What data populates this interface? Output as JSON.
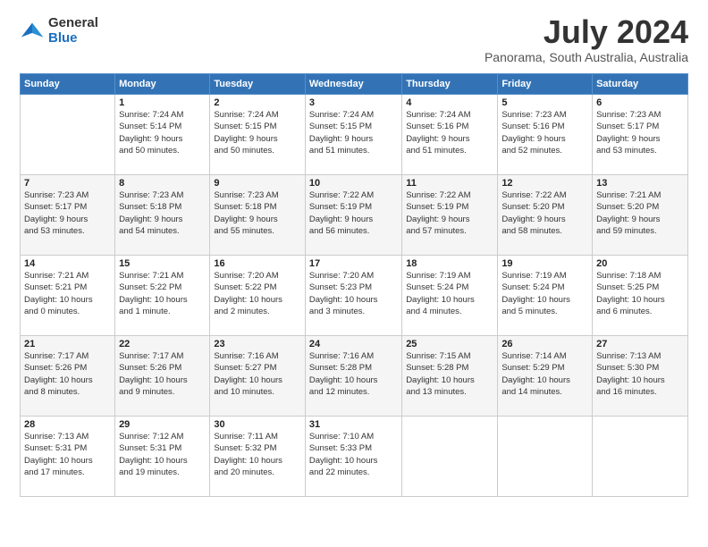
{
  "logo": {
    "line1": "General",
    "line2": "Blue"
  },
  "title": "July 2024",
  "location": "Panorama, South Australia, Australia",
  "header_days": [
    "Sunday",
    "Monday",
    "Tuesday",
    "Wednesday",
    "Thursday",
    "Friday",
    "Saturday"
  ],
  "weeks": [
    [
      {
        "day": "",
        "info": ""
      },
      {
        "day": "1",
        "info": "Sunrise: 7:24 AM\nSunset: 5:14 PM\nDaylight: 9 hours\nand 50 minutes."
      },
      {
        "day": "2",
        "info": "Sunrise: 7:24 AM\nSunset: 5:15 PM\nDaylight: 9 hours\nand 50 minutes."
      },
      {
        "day": "3",
        "info": "Sunrise: 7:24 AM\nSunset: 5:15 PM\nDaylight: 9 hours\nand 51 minutes."
      },
      {
        "day": "4",
        "info": "Sunrise: 7:24 AM\nSunset: 5:16 PM\nDaylight: 9 hours\nand 51 minutes."
      },
      {
        "day": "5",
        "info": "Sunrise: 7:23 AM\nSunset: 5:16 PM\nDaylight: 9 hours\nand 52 minutes."
      },
      {
        "day": "6",
        "info": "Sunrise: 7:23 AM\nSunset: 5:17 PM\nDaylight: 9 hours\nand 53 minutes."
      }
    ],
    [
      {
        "day": "7",
        "info": "Sunrise: 7:23 AM\nSunset: 5:17 PM\nDaylight: 9 hours\nand 53 minutes."
      },
      {
        "day": "8",
        "info": "Sunrise: 7:23 AM\nSunset: 5:18 PM\nDaylight: 9 hours\nand 54 minutes."
      },
      {
        "day": "9",
        "info": "Sunrise: 7:23 AM\nSunset: 5:18 PM\nDaylight: 9 hours\nand 55 minutes."
      },
      {
        "day": "10",
        "info": "Sunrise: 7:22 AM\nSunset: 5:19 PM\nDaylight: 9 hours\nand 56 minutes."
      },
      {
        "day": "11",
        "info": "Sunrise: 7:22 AM\nSunset: 5:19 PM\nDaylight: 9 hours\nand 57 minutes."
      },
      {
        "day": "12",
        "info": "Sunrise: 7:22 AM\nSunset: 5:20 PM\nDaylight: 9 hours\nand 58 minutes."
      },
      {
        "day": "13",
        "info": "Sunrise: 7:21 AM\nSunset: 5:20 PM\nDaylight: 9 hours\nand 59 minutes."
      }
    ],
    [
      {
        "day": "14",
        "info": "Sunrise: 7:21 AM\nSunset: 5:21 PM\nDaylight: 10 hours\nand 0 minutes."
      },
      {
        "day": "15",
        "info": "Sunrise: 7:21 AM\nSunset: 5:22 PM\nDaylight: 10 hours\nand 1 minute."
      },
      {
        "day": "16",
        "info": "Sunrise: 7:20 AM\nSunset: 5:22 PM\nDaylight: 10 hours\nand 2 minutes."
      },
      {
        "day": "17",
        "info": "Sunrise: 7:20 AM\nSunset: 5:23 PM\nDaylight: 10 hours\nand 3 minutes."
      },
      {
        "day": "18",
        "info": "Sunrise: 7:19 AM\nSunset: 5:24 PM\nDaylight: 10 hours\nand 4 minutes."
      },
      {
        "day": "19",
        "info": "Sunrise: 7:19 AM\nSunset: 5:24 PM\nDaylight: 10 hours\nand 5 minutes."
      },
      {
        "day": "20",
        "info": "Sunrise: 7:18 AM\nSunset: 5:25 PM\nDaylight: 10 hours\nand 6 minutes."
      }
    ],
    [
      {
        "day": "21",
        "info": "Sunrise: 7:17 AM\nSunset: 5:26 PM\nDaylight: 10 hours\nand 8 minutes."
      },
      {
        "day": "22",
        "info": "Sunrise: 7:17 AM\nSunset: 5:26 PM\nDaylight: 10 hours\nand 9 minutes."
      },
      {
        "day": "23",
        "info": "Sunrise: 7:16 AM\nSunset: 5:27 PM\nDaylight: 10 hours\nand 10 minutes."
      },
      {
        "day": "24",
        "info": "Sunrise: 7:16 AM\nSunset: 5:28 PM\nDaylight: 10 hours\nand 12 minutes."
      },
      {
        "day": "25",
        "info": "Sunrise: 7:15 AM\nSunset: 5:28 PM\nDaylight: 10 hours\nand 13 minutes."
      },
      {
        "day": "26",
        "info": "Sunrise: 7:14 AM\nSunset: 5:29 PM\nDaylight: 10 hours\nand 14 minutes."
      },
      {
        "day": "27",
        "info": "Sunrise: 7:13 AM\nSunset: 5:30 PM\nDaylight: 10 hours\nand 16 minutes."
      }
    ],
    [
      {
        "day": "28",
        "info": "Sunrise: 7:13 AM\nSunset: 5:31 PM\nDaylight: 10 hours\nand 17 minutes."
      },
      {
        "day": "29",
        "info": "Sunrise: 7:12 AM\nSunset: 5:31 PM\nDaylight: 10 hours\nand 19 minutes."
      },
      {
        "day": "30",
        "info": "Sunrise: 7:11 AM\nSunset: 5:32 PM\nDaylight: 10 hours\nand 20 minutes."
      },
      {
        "day": "31",
        "info": "Sunrise: 7:10 AM\nSunset: 5:33 PM\nDaylight: 10 hours\nand 22 minutes."
      },
      {
        "day": "",
        "info": ""
      },
      {
        "day": "",
        "info": ""
      },
      {
        "day": "",
        "info": ""
      }
    ]
  ]
}
